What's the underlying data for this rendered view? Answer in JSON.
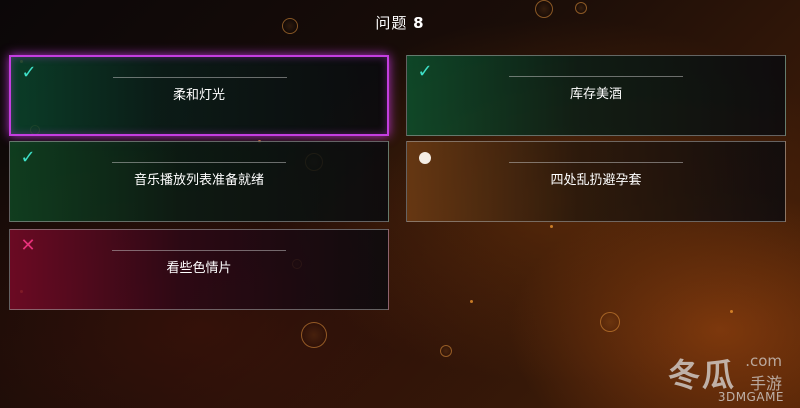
{
  "header": {
    "title_prefix": "问题",
    "question_number": "8"
  },
  "options": [
    {
      "label": "柔和灯光",
      "status": "checked",
      "selected": true
    },
    {
      "label": "库存美酒",
      "status": "checked",
      "selected": false
    },
    {
      "label": "音乐播放列表准备就绪",
      "status": "checked",
      "selected": false
    },
    {
      "label": "四处乱扔避孕套",
      "status": "pending",
      "selected": false
    },
    {
      "label": "看些色情片",
      "status": "crossed",
      "selected": false
    }
  ],
  "icons": {
    "check": "check-icon",
    "cross": "cross-icon",
    "dot": "dot-icon"
  },
  "colors": {
    "selection_border": "#c43ee0",
    "check": "#3ee0c8",
    "cross": "#e8307a"
  },
  "watermark": {
    "main": "冬瓜",
    "domain": ".com",
    "sub": "手游",
    "brand": "3DMGAME"
  }
}
